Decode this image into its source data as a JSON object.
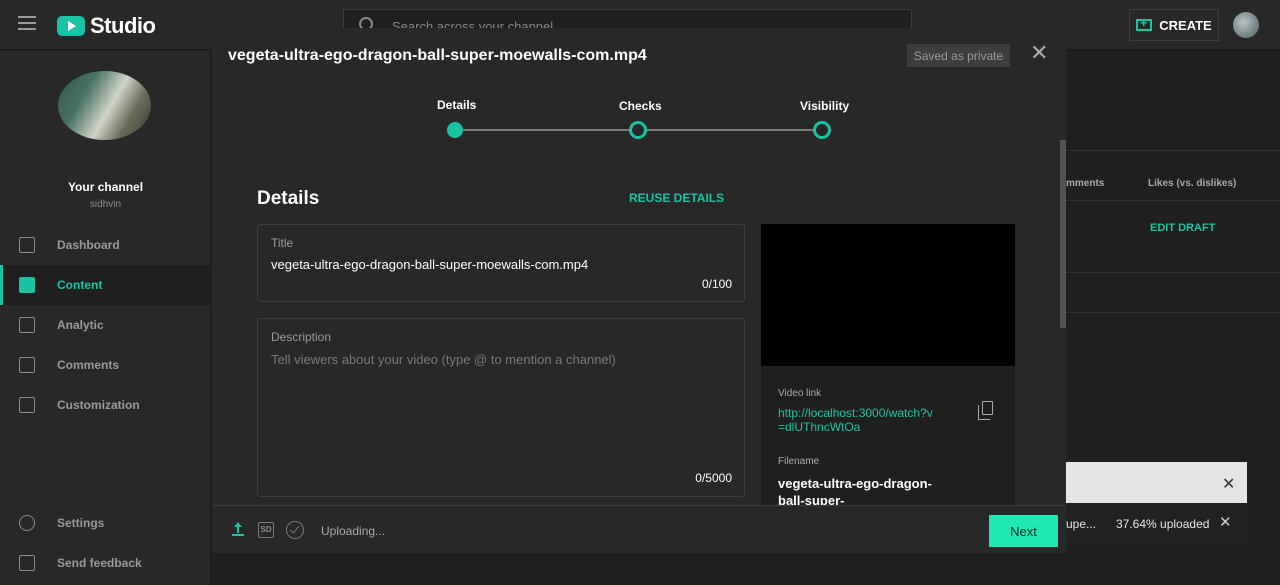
{
  "header": {
    "app_name": "Studio",
    "search_placeholder": "Search across your channel",
    "create_label": "CREATE"
  },
  "sidebar": {
    "channel_label": "Your channel",
    "channel_name": "sidhvin",
    "items": [
      {
        "label": "Dashboard",
        "icon": "dashboard-icon"
      },
      {
        "label": "Content",
        "icon": "content-icon",
        "active": true
      },
      {
        "label": "Analytic",
        "icon": "analytics-icon"
      },
      {
        "label": "Comments",
        "icon": "comments-icon"
      },
      {
        "label": "Customization",
        "icon": "customization-icon"
      }
    ],
    "bottom_items": [
      {
        "label": "Settings",
        "icon": "gear-icon"
      },
      {
        "label": "Send feedback",
        "icon": "feedback-icon"
      }
    ]
  },
  "background": {
    "col_comments": "mments",
    "col_likes": "Likes (vs. dislikes)",
    "edit_draft": "EDIT DRAFT"
  },
  "toast": {
    "truncated_text": "upe...",
    "progress_text": "37.64% uploaded"
  },
  "modal": {
    "title": "vegeta-ultra-ego-dragon-ball-super-moewalls-com.mp4",
    "saved_badge": "Saved as private",
    "steps": [
      "Details",
      "Checks",
      "Visibility"
    ],
    "section_title": "Details",
    "reuse_label": "REUSE DETAILS",
    "title_field": {
      "label": "Title",
      "value": "vegeta-ultra-ego-dragon-ball-super-moewalls-com.mp4",
      "count": "0/100"
    },
    "description_field": {
      "label": "Description",
      "placeholder": "Tell viewers about your video (type @ to mention a channel)",
      "count": "0/5000"
    },
    "preview": {
      "video_link_label": "Video link",
      "video_link": "http://localhost:3000/watch?v=dlUThncWtOa",
      "filename_label": "Filename",
      "filename": "vegeta-ultra-ego-dragon-ball-super-"
    },
    "footer": {
      "sd_badge": "SD",
      "status": "Uploading...",
      "next_label": "Next"
    }
  },
  "colors": {
    "accent": "#19c3a4",
    "next_button": "#1de9b6",
    "background": "#1f1f1f",
    "panel": "#282828"
  }
}
